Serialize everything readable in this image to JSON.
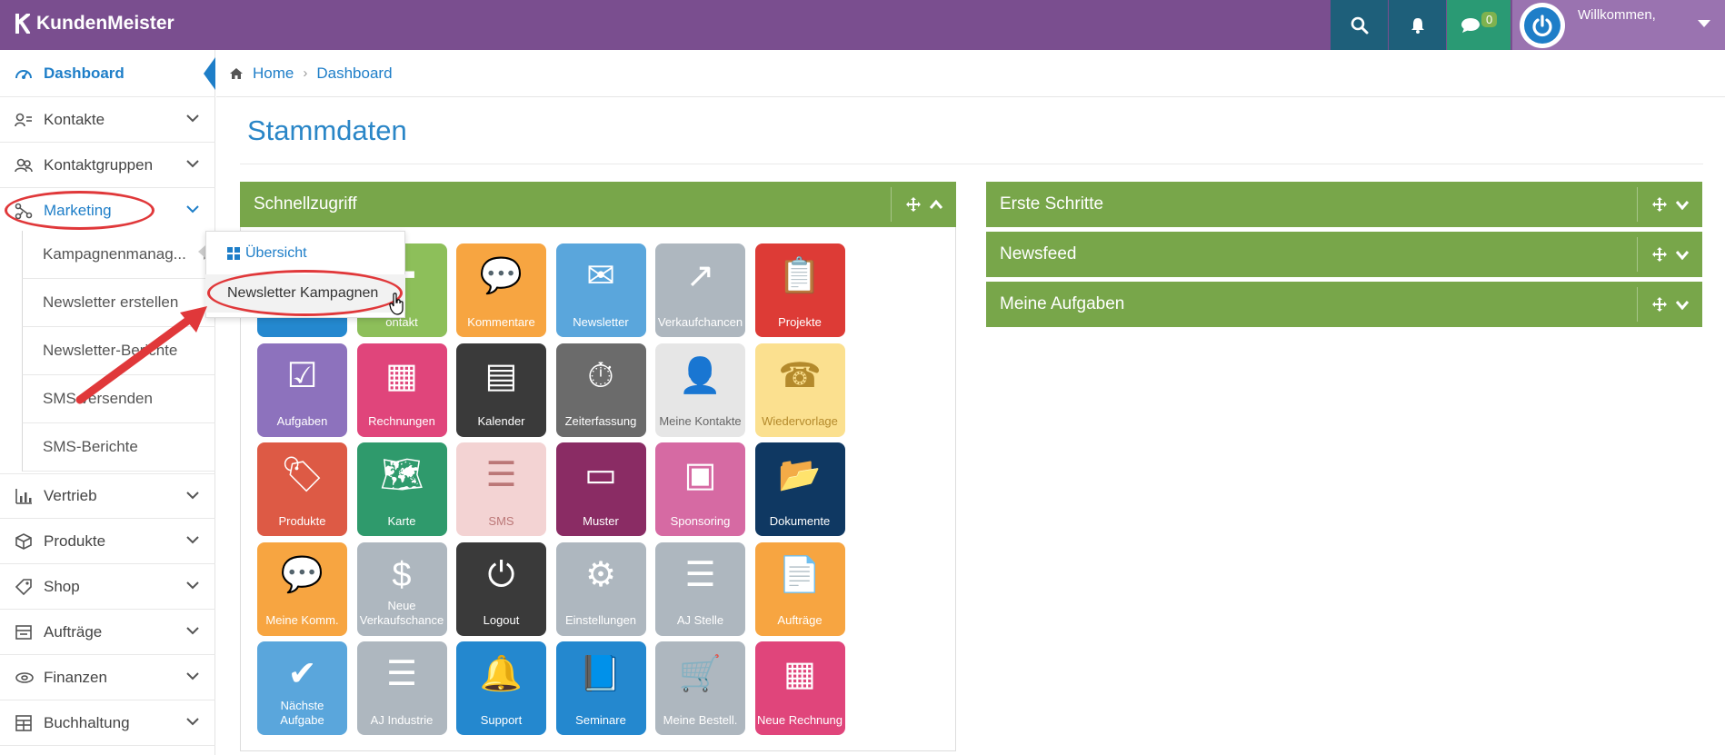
{
  "app": {
    "brand": "KundenMeister"
  },
  "topbar": {
    "chat_count": "0",
    "welcome": "Willkommen,"
  },
  "breadcrumb": {
    "home": "Home",
    "current": "Dashboard"
  },
  "page": {
    "title": "Stammdaten"
  },
  "sidebar": {
    "items": [
      {
        "label": "Dashboard",
        "icon": "dashboard-icon"
      },
      {
        "label": "Kontakte",
        "icon": "contacts-icon"
      },
      {
        "label": "Kontaktgruppen",
        "icon": "groups-icon"
      },
      {
        "label": "Marketing",
        "icon": "share-icon"
      },
      {
        "label": "Vertrieb",
        "icon": "bar-chart-icon"
      },
      {
        "label": "Produkte",
        "icon": "box-icon"
      },
      {
        "label": "Shop",
        "icon": "tag-icon"
      },
      {
        "label": "Aufträge",
        "icon": "orders-icon"
      },
      {
        "label": "Finanzen",
        "icon": "money-icon"
      },
      {
        "label": "Buchhaltung",
        "icon": "accounting-icon"
      }
    ],
    "marketing_sub": [
      "Kampagnenmanag...",
      "Newsletter erstellen",
      "Newsletter-Berichte",
      "SMS versenden",
      "SMS-Berichte"
    ]
  },
  "popup": {
    "overview": "Übersicht",
    "newsletter_campaigns": "Newsletter Kampagnen"
  },
  "panels": {
    "quick": "Schnellzugriff",
    "first_steps": "Erste Schritte",
    "newsfeed": "Newsfeed",
    "tasks": "Meine Aufgaben"
  },
  "tiles": [
    {
      "label": "",
      "color": "#2488cf",
      "icon": "contact-card-icon"
    },
    {
      "label": "ontakt",
      "color": "#8dbf5a",
      "icon": "add-contact-icon"
    },
    {
      "label": "Kommentare",
      "color": "#f7a541",
      "icon": "comments-icon"
    },
    {
      "label": "Newsletter",
      "color": "#5aa6dc",
      "icon": "newsletter-icon"
    },
    {
      "label": "Verkaufchancen",
      "color": "#aeb7bf",
      "icon": "coins-chart-icon"
    },
    {
      "label": "Projekte",
      "color": "#dd3b36",
      "icon": "clipboard-icon"
    },
    {
      "label": "Aufgaben",
      "color": "#8d72bd",
      "icon": "checkbox-icon"
    },
    {
      "label": "Rechnungen",
      "color": "#e0457b",
      "icon": "calculator-icon"
    },
    {
      "label": "Kalender",
      "color": "#3a3a3a",
      "icon": "calendar-icon"
    },
    {
      "label": "Zeiterfassung",
      "color": "#6b6b6b",
      "icon": "stopwatch-icon"
    },
    {
      "label": "Meine Kontakte",
      "color": "#e6e6e6",
      "icon": "address-book-icon"
    },
    {
      "label": "Wiedervorlage",
      "color": "#fbe08f",
      "icon": "phone-clock-icon"
    },
    {
      "label": "Produkte",
      "color": "#dd5a45",
      "icon": "price-tag-icon"
    },
    {
      "label": "Karte",
      "color": "#2f9a6c",
      "icon": "map-icon"
    },
    {
      "label": "SMS",
      "color": "#f3d3d3",
      "icon": "sms-icon"
    },
    {
      "label": "Muster",
      "color": "#8a2c64",
      "icon": "archive-icon"
    },
    {
      "label": "Sponsoring",
      "color": "#d66aa3",
      "icon": "layout-icon"
    },
    {
      "label": "Dokumente",
      "color": "#0f3862",
      "icon": "folder-icon"
    },
    {
      "label": "Meine Komm.",
      "color": "#f7a541",
      "icon": "speech-bubble-icon"
    },
    {
      "label": "Neue Verkaufschance",
      "color": "#aeb7bf",
      "icon": "dollar-icon"
    },
    {
      "label": "Logout",
      "color": "#3a3a3a",
      "icon": "power-icon"
    },
    {
      "label": "Einstellungen",
      "color": "#aeb7bf",
      "icon": "gears-icon"
    },
    {
      "label": "AJ Stelle",
      "color": "#aeb7bf",
      "icon": "list-icon"
    },
    {
      "label": "Aufträge",
      "color": "#f7a541",
      "icon": "document-icon"
    },
    {
      "label": "Nächste Aufgabe",
      "color": "#5aa6dc",
      "icon": "checkmark-icon"
    },
    {
      "label": "AJ Industrie",
      "color": "#aeb7bf",
      "icon": "list-icon"
    },
    {
      "label": "Support",
      "color": "#2488cf",
      "icon": "bell-icon"
    },
    {
      "label": "Seminare",
      "color": "#2488cf",
      "icon": "book-icon"
    },
    {
      "label": "Meine Bestell.",
      "color": "#aeb7bf",
      "icon": "cart-icon"
    },
    {
      "label": "Neue Rechnung",
      "color": "#e0457b",
      "icon": "calculator-icon"
    }
  ]
}
